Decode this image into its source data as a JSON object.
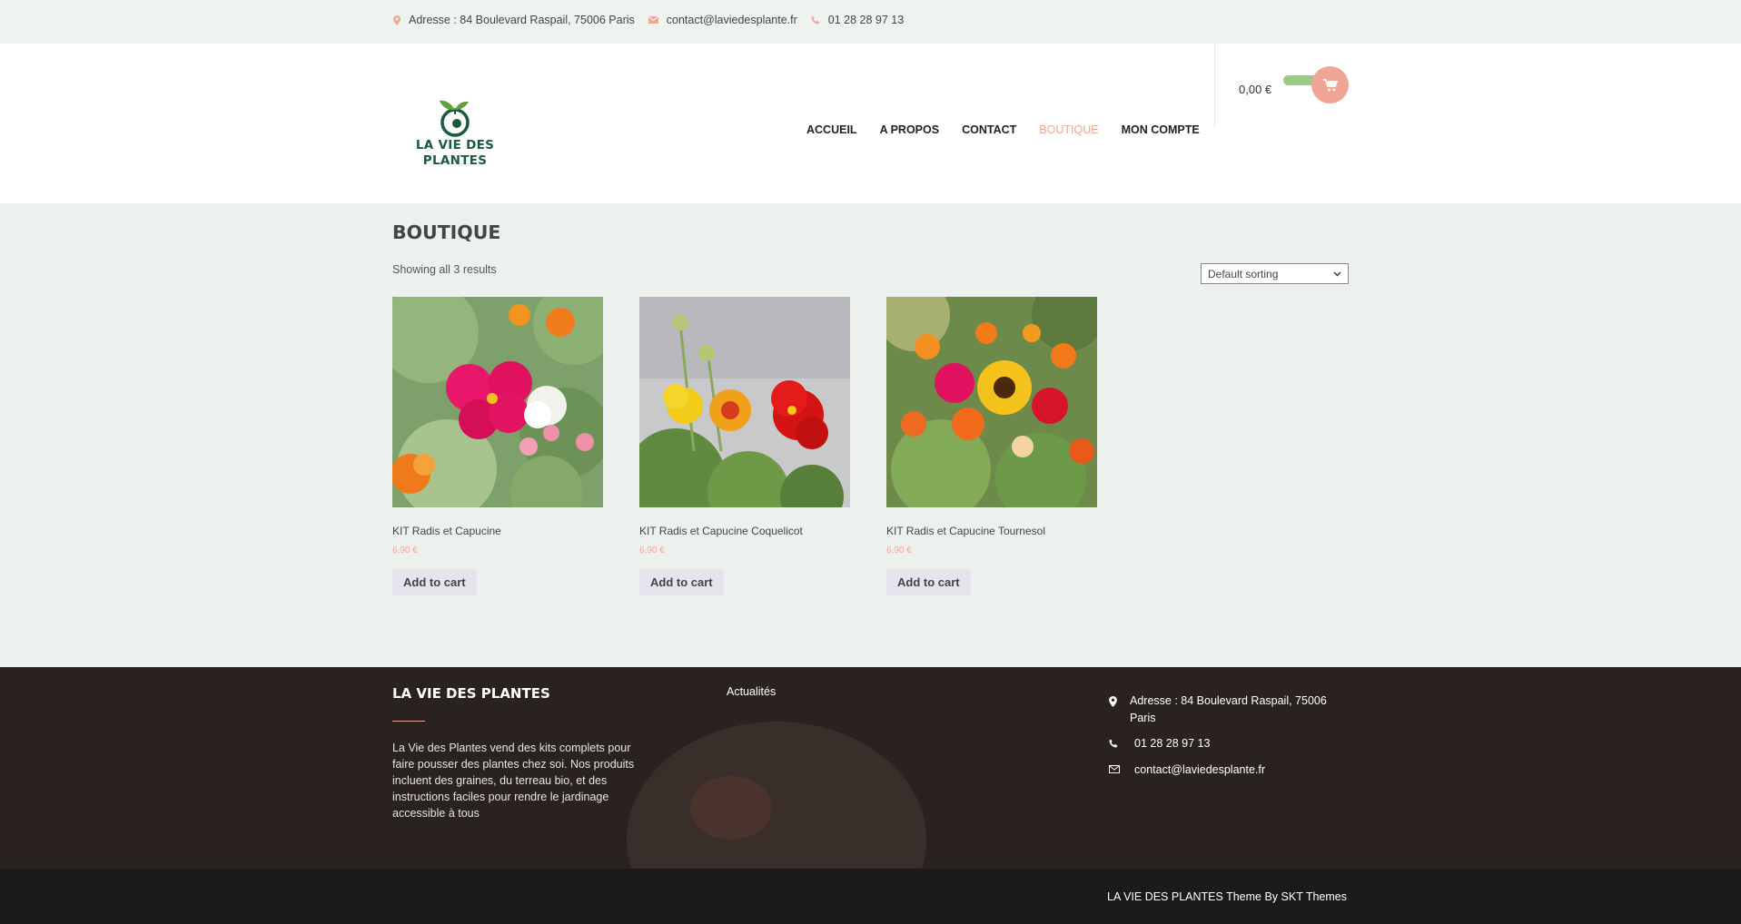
{
  "topbar": {
    "address": "Adresse : 84 Boulevard Raspail, 75006 Paris",
    "email": "contact@laviedesplante.fr",
    "phone": "01 28 28 97 13"
  },
  "header": {
    "logo_line1": "LA VIE DES",
    "logo_line2": "PLANTES",
    "nav": [
      {
        "label": "ACCUEIL"
      },
      {
        "label": "A PROPOS"
      },
      {
        "label": "CONTACT"
      },
      {
        "label": "BOUTIQUE"
      },
      {
        "label": "MON COMPTE"
      }
    ],
    "active_nav": "BOUTIQUE",
    "cart_total": "0,00 €"
  },
  "main": {
    "title": "BOUTIQUE",
    "results": "Showing all 3 results",
    "sorting": "Default sorting",
    "products": [
      {
        "name": "KIT Radis et Capucine",
        "price": "6,90 €",
        "button": "Add to cart"
      },
      {
        "name": "KIT Radis et Capucine Coquelicot",
        "price": "6,90 €",
        "button": "Add to cart"
      },
      {
        "name": "KIT Radis et Capucine Tournesol",
        "price": "6,90 €",
        "button": "Add to cart"
      }
    ]
  },
  "footer": {
    "title": "LA VIE DES PLANTES",
    "description": "La Vie des Plantes vend des kits complets pour faire pousser des plantes chez soi. Nos produits incluent des graines, du terreau bio, et des instructions faciles pour rendre le jardinage accessible à tous",
    "actualites": "Actualités",
    "address": "Adresse : 84 Boulevard Raspail, 75006 Paris",
    "phone": "01 28 28 97 13",
    "email": "contact@laviedesplante.fr",
    "credit": "LA VIE DES PLANTES Theme By SKT Themes"
  },
  "colors": {
    "accent": "#f0a597",
    "brand_green": "#1d5a3b",
    "cart_pill": "#9ccb87"
  },
  "icons": [
    "map-pin-icon",
    "envelope-icon",
    "phone-icon",
    "cart-icon",
    "chevron-down-icon"
  ]
}
